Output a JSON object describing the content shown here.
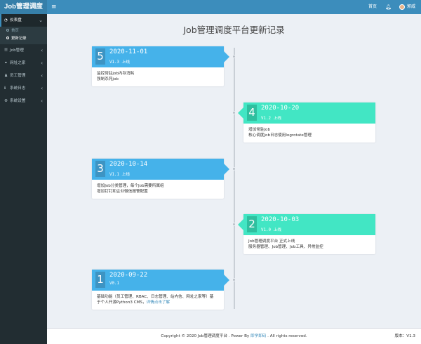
{
  "app": {
    "logo": "Job管理调度"
  },
  "header": {
    "home": "首页",
    "username": "郭威",
    "menu_icon": "hamburger-icon",
    "bell_icon": "bell-icon"
  },
  "sidebar": {
    "items": [
      {
        "label": "仪表盘",
        "icon": "dashboard-icon"
      },
      {
        "label": "Job管理",
        "icon": "list-icon"
      },
      {
        "label": "网址之家",
        "icon": "link-icon"
      },
      {
        "label": "员工管理",
        "icon": "user-icon"
      },
      {
        "label": "系统日志",
        "icon": "info-icon"
      },
      {
        "label": "系统设置",
        "icon": "gear-icon"
      }
    ],
    "submenu": [
      {
        "label": "首页"
      },
      {
        "label": "更新记录"
      }
    ]
  },
  "main": {
    "title": "Job管理调度平台更新记录",
    "entries": [
      {
        "num": "5",
        "date": "2020-11-01",
        "version": "V1.3 上线",
        "lines": [
          "监控常驻job内存消耗",
          "强制杀死job"
        ]
      },
      {
        "num": "4",
        "date": "2020-10-20",
        "version": "V1.2 上线",
        "lines": [
          "增加常驻Job",
          "核心调度Job日志使用logrotate管理"
        ]
      },
      {
        "num": "3",
        "date": "2020-10-14",
        "version": "V1.1 上线",
        "lines": [
          "增加Job分类管理，每个Job需要所属组",
          "增加钉钉和企业微信报警配置"
        ]
      },
      {
        "num": "2",
        "date": "2020-10-03",
        "version": "V1.0 上线",
        "lines": [
          "Job管理调度平台 正式上线",
          "服务器管理、Job管理、Job工具、异常监控"
        ]
      },
      {
        "num": "1",
        "date": "2020-09-22",
        "version": "V0.1",
        "lines": [
          "基础功能（员工管理、RBAC、日志管理、站内信、网址之家等）基",
          "于个人开源Python3 CMS，"
        ],
        "link": "详情点击了解"
      }
    ]
  },
  "footer": {
    "copyright_prefix": "Copyright © 2020 Job管理调度平台 . Power By ",
    "brand": "即学即码",
    "copyright_suffix": " . All rights reserved.",
    "version": "版本：V1.3"
  },
  "colors": {
    "header": "#3c8dbc",
    "logo": "#367fa9",
    "sidebar": "#222d32",
    "card_blue": "#45b2ea",
    "card_green": "#42e6c4",
    "background": "#ecf0f5"
  }
}
